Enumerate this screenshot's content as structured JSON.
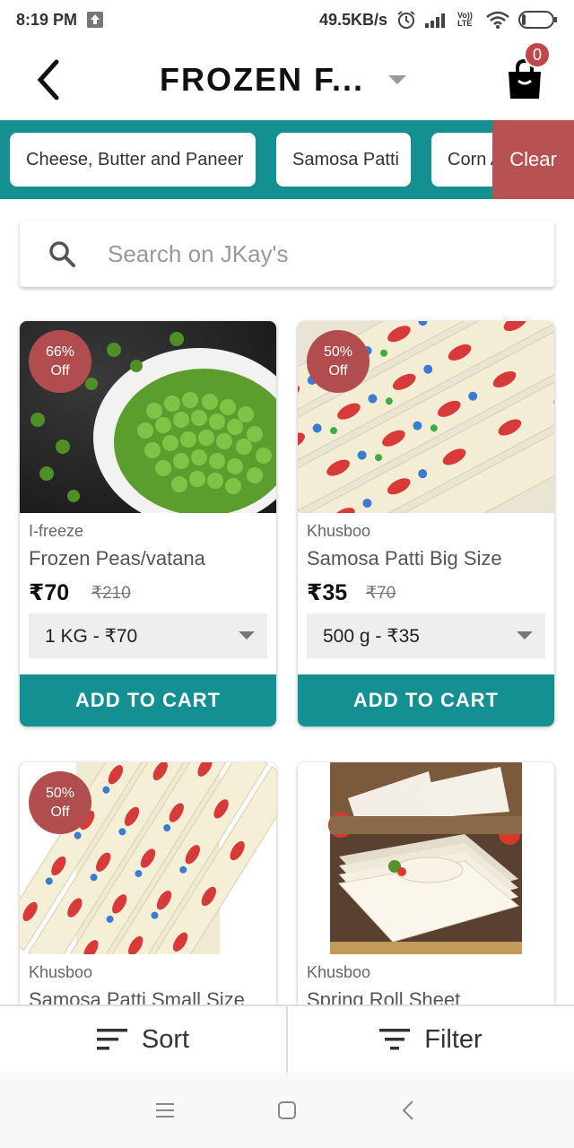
{
  "status_bar": {
    "time": "8:19 PM",
    "network_speed": "49.5KB/s",
    "lte_label": "Vo)) LTE"
  },
  "app_bar": {
    "title": "FROZEN F...",
    "cart_count": "0"
  },
  "categories": {
    "chips": [
      "Cheese, Butter and Paneer",
      "Samosa Patti",
      "Corn A"
    ],
    "clear_label": "Clear"
  },
  "search": {
    "placeholder": "Search on JKay's"
  },
  "products": [
    {
      "discount_pct": "66%",
      "discount_off": "Off",
      "brand": "I-freeze",
      "name": "Frozen Peas/vatana",
      "price": "₹70",
      "mrp": "₹210",
      "variant": "1 KG - ₹70",
      "add_label": "ADD TO CART"
    },
    {
      "discount_pct": "50%",
      "discount_off": "Off",
      "brand": "Khusboo",
      "name": "Samosa Patti Big Size",
      "price": "₹35",
      "mrp": "₹70",
      "variant": "500 g - ₹35",
      "add_label": "ADD TO CART"
    },
    {
      "discount_pct": "50%",
      "discount_off": "Off",
      "brand": "Khusboo",
      "name": "Samosa Patti Small Size"
    },
    {
      "brand": "Khusboo",
      "name": "Spring Roll Sheet"
    }
  ],
  "bottom_bar": {
    "sort_label": "Sort",
    "filter_label": "Filter"
  },
  "colors": {
    "teal": "#148f92",
    "badge_red": "#b24d4f",
    "clear_red": "#b85152"
  }
}
